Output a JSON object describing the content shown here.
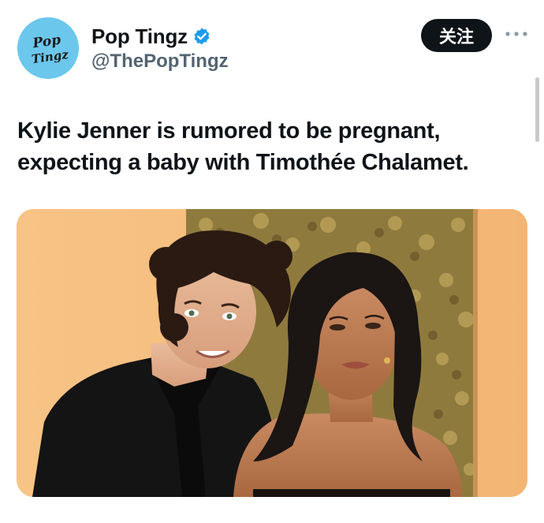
{
  "author": {
    "display_name": "Pop Tingz",
    "handle": "@ThePopTingz",
    "verified": true,
    "avatar_text_line1": "Pop",
    "avatar_text_line2": "Tingz"
  },
  "actions": {
    "follow_label": "关注",
    "more_icon": "more-horizontal-icon"
  },
  "tweet": {
    "text": "Kylie Jenner is rumored to be pregnant, expecting a baby with Timothée Chalamet."
  },
  "colors": {
    "avatar_bg": "#6cc7ec",
    "verified_blue": "#1d9bf0",
    "follow_bg": "#0f1419",
    "handle_gray": "#536471",
    "photo_backdrop": "#f6bd7a"
  }
}
